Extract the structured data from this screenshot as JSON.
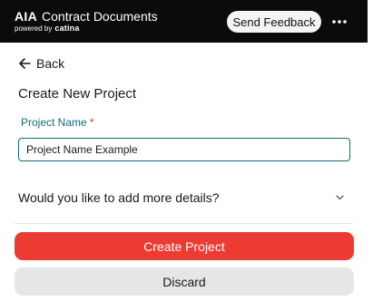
{
  "header": {
    "brand_strong": "AIA",
    "brand_light": "Contract Documents",
    "powered_by": "powered by",
    "powered_brand": "catina",
    "feedback_label": "Send Feedback",
    "more_icon": "more-horizontal-icon"
  },
  "nav": {
    "back_label": "Back",
    "back_icon": "arrow-left-icon"
  },
  "form": {
    "title": "Create New Project",
    "project_name_label": "Project Name",
    "required_marker": "*",
    "project_name_value": "Project Name Example",
    "details_label": "Would you like to add more details?",
    "details_icon": "chevron-down-icon"
  },
  "actions": {
    "create_label": "Create Project",
    "discard_label": "Discard"
  },
  "colors": {
    "header_bg": "#0b0b0b",
    "accent_teal": "#0e6e7a",
    "primary_red": "#ec3b32",
    "secondary_gray": "#e6e6e6"
  }
}
